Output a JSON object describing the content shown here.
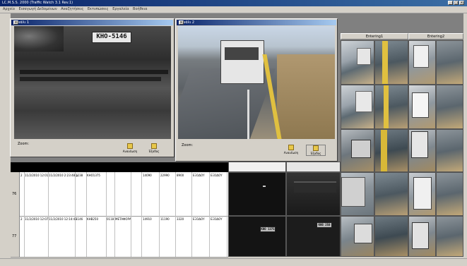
{
  "app": {
    "title": "LC.M.S.S. 2000 (Traffic Watch 3.1 Rev.1)",
    "window_controls": [
      "_",
      "□",
      "×"
    ]
  },
  "menu": [
    "Αρχείο",
    "Εισαγωγή Δεδομένων",
    "Αναζητήσεις",
    "Εκτυπώσεις",
    "Εργαλεία",
    "Βοήθεια"
  ],
  "camera_windows": [
    {
      "title": "Κανάλι 1",
      "zoom_label": "Zoom:",
      "refresh_label": "Ανανέωση",
      "exit_label": "Έξοδος",
      "plate": "KHO-5146"
    },
    {
      "title": "Κανάλι 2",
      "zoom_label": "Zoom:",
      "refresh_label": "Ανανέωση",
      "exit_label": "Έξοδος"
    }
  ],
  "thumb_columns": [
    "Entering1",
    "Entering2"
  ],
  "records": [
    {
      "row": "76",
      "cells": [
        "2",
        "11/2/2010 12:01",
        "11/2/2010 2:23:48 μ",
        "1238",
        "ΚΗΟ1375",
        "",
        "",
        "",
        "14090",
        "22990",
        "8900",
        "ΕΞΟΔΟΥ",
        "ΕΞΟΔΟΥ"
      ]
    },
    {
      "row": "77",
      "cells": [
        "2",
        "11/2/2010 12:07",
        "11/2/2010 12:14:48 ",
        "1146",
        "ΚΗΒ250",
        "0118",
        "ΜΕΤΑΦΟΡΑ",
        "",
        "14910",
        "11190",
        "3320",
        "ΕΞΟΔΟΥ",
        "ΕΞΟΔΟΥ"
      ]
    }
  ],
  "plates": {
    "night_thumb_1": "KHO 1375",
    "night_thumb_2": "KHB 250"
  },
  "colors": {
    "title_bar": "#0a246a",
    "window_face": "#d4d0c8"
  }
}
